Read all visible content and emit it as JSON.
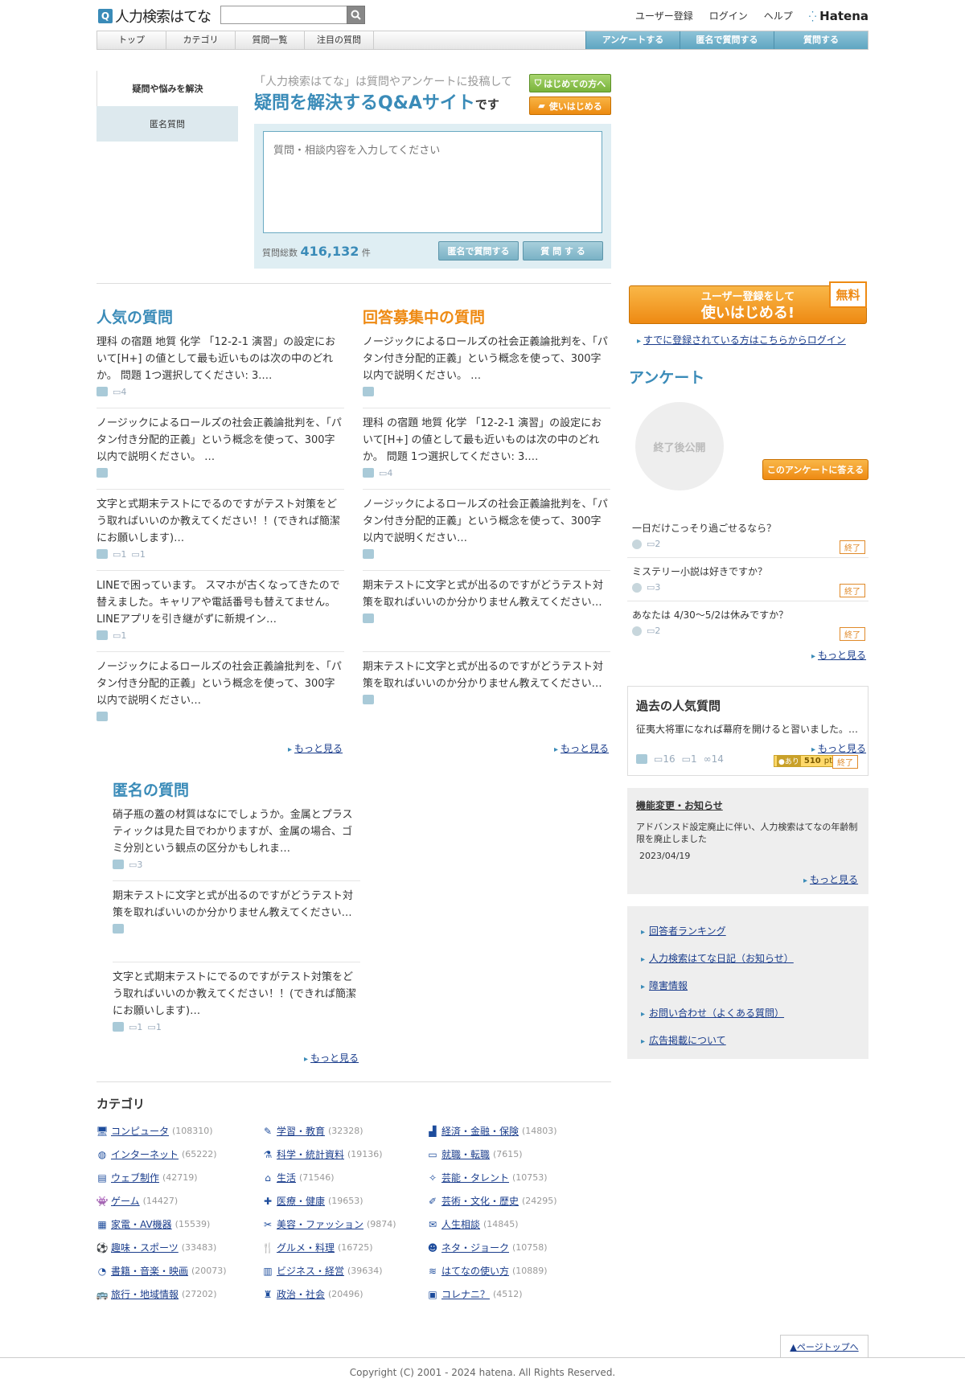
{
  "header": {
    "logo_text": "人力検索はてな",
    "links": [
      "ユーザー登録",
      "ログイン",
      "ヘルプ"
    ],
    "hatena": "Hatena"
  },
  "nav": {
    "tabs": [
      "トップ",
      "カテゴリ",
      "質問一覧",
      "注目の質問"
    ],
    "actions": [
      "アンケートする",
      "匿名で質問する",
      "質問する"
    ]
  },
  "sidetabs": [
    "疑問や悩みを解決",
    "匿名質問"
  ],
  "intro": {
    "line1": "「人力検索はてな」は質問やアンケートに投稿して",
    "line2": "疑問を解決するQ&Aサイト",
    "line2_suffix": "です",
    "btn_first": "はじめての方へ",
    "btn_howto": "使いはじめる"
  },
  "askform": {
    "placeholder": "質問・相談内容を入力してください",
    "count_label": "質問総数",
    "count": "416,132",
    "count_unit": "件",
    "btn_anon": "匿名で質問する",
    "btn_ask": "質 問 す る"
  },
  "popular": {
    "title": "人気の質問",
    "items": [
      {
        "text": "理科 の宿題 地質 化学 「12-2-1 演習」の設定において[H+] の値として最も近いものは次の中のどれか。 問題 1つ選択してください: 3.…",
        "ans": "4",
        "bm": ""
      },
      {
        "text": "ノージックによるロールズの社会正義論批判を、「パタン付き分配的正義」という概念を使って、300字以内で説明ください。 …",
        "ans": "",
        "bm": ""
      },
      {
        "text": "文字と式期末テストにでるのですがテスト対策をどう取ればいいのか教えてください！！(できれば簡潔にお願いします)…",
        "ans": "1",
        "bm": "1"
      },
      {
        "text": "LINEで困っています。 スマホが古くなってきたので替えました。キャリアや電話番号も替えてません。LINEアプリを引き継がずに新規イン…",
        "ans": "1",
        "bm": ""
      },
      {
        "text": "ノージックによるロールズの社会正義論批判を、「パタン付き分配的正義」という概念を使って、300字以内で説明ください…",
        "ans": "",
        "bm": ""
      }
    ],
    "more": "もっと見る"
  },
  "recruiting": {
    "title": "回答募集中の質問",
    "items": [
      {
        "text": "ノージックによるロールズの社会正義論批判を、「パタン付き分配的正義」という概念を使って、300字以内で説明ください。 …",
        "ans": "",
        "bm": ""
      },
      {
        "text": "理科 の宿題 地質 化学 「12-2-1 演習」の設定において[H+] の値として最も近いものは次の中のどれか。 問題 1つ選択してください: 3.…",
        "ans": "4",
        "bm": ""
      },
      {
        "text": "ノージックによるロールズの社会正義論批判を、「パタン付き分配的正義」という概念を使って、300字以内で説明ください…",
        "ans": "",
        "bm": ""
      },
      {
        "text": "期末テストに文字と式が出るのですがどうテスト対策を取ればいいのか分かりません教えてください…",
        "ans": "",
        "bm": ""
      },
      {
        "text": "期末テストに文字と式が出るのですがどうテスト対策を取ればいいのか分かりません教えてください…",
        "ans": "",
        "bm": ""
      }
    ],
    "more": "もっと見る"
  },
  "anonymous": {
    "title": "匿名の質問",
    "items": [
      {
        "text": "硝子瓶の蓋の材質はなにでしょうか。金属とプラスティックは見た目でわかりますが、金属の場合、ゴミ分別という観点の区分かもしれま…",
        "ans": "3",
        "bm": ""
      },
      {
        "text": "期末テストに文字と式が出るのですがどうテスト対策を取ればいいのか分かりません教えてください…",
        "ans": "",
        "bm": ""
      },
      {
        "text": "文字と式期末テストにでるのですがテスト対策をどう取ればいいのか教えてください！！(できれば簡潔にお願いします)…",
        "ans": "1",
        "bm": "1"
      }
    ],
    "more": "もっと見る"
  },
  "register": {
    "line1": "ユーザー登録をして",
    "line2": "使いはじめる!",
    "free": "無料",
    "already": "すでに登録されている方はこちらからログイン"
  },
  "survey": {
    "title": "アンケート",
    "circle": "終了後公開",
    "answer_btn": "このアンケートに答える",
    "items": [
      {
        "text": "一日だけこっそり過ごせるなら？",
        "ans": "2",
        "status": "終了"
      },
      {
        "text": "ミステリー小説は好きですか？",
        "ans": "3",
        "status": "終了"
      },
      {
        "text": "あなたは 4/30〜5/2は休みですか？",
        "ans": "2",
        "status": "終了"
      }
    ],
    "more": "もっと見る"
  },
  "past": {
    "title": "過去の人気質問",
    "text": "征夷大将軍になれば幕府を開けると習いました。…",
    "ans": "16",
    "bm": "1",
    "links": "14",
    "point_tag": "あり",
    "points": "510",
    "points_unit": "pt",
    "status": "終了",
    "more": "もっと見る"
  },
  "news": {
    "title": "機能変更・お知らせ",
    "body": "アドバンスド設定廃止に伴い、人力検索はてなの年齢制限を廃止しました",
    "date": "2023/04/19",
    "more": "もっと見る"
  },
  "links": [
    "回答者ランキング",
    "人力検索はてな日記（お知らせ）",
    "障害情報",
    "お問い合わせ（よくある質問）",
    "広告掲載について"
  ],
  "categories": {
    "title": "カテゴリ",
    "items": [
      {
        "name": "コンピュータ",
        "count": "(108310)",
        "icon": "computer-icon",
        "glyph": "🖥"
      },
      {
        "name": "インターネット",
        "count": "(65222)",
        "icon": "globe-icon",
        "glyph": "◍"
      },
      {
        "name": "ウェブ制作",
        "count": "(42719)",
        "icon": "web-icon",
        "glyph": "▤"
      },
      {
        "name": "ゲーム",
        "count": "(14427)",
        "icon": "game-icon",
        "glyph": "👾"
      },
      {
        "name": "家電・AV機器",
        "count": "(15539)",
        "icon": "appliance-icon",
        "glyph": "▦"
      },
      {
        "name": "趣味・スポーツ",
        "count": "(33483)",
        "icon": "ball-icon",
        "glyph": "⚽"
      },
      {
        "name": "書籍・音楽・映画",
        "count": "(20073)",
        "icon": "disc-icon",
        "glyph": "◔"
      },
      {
        "name": "旅行・地域情報",
        "count": "(27202)",
        "icon": "travel-icon",
        "glyph": "🚌"
      },
      {
        "name": "学習・教育",
        "count": "(32328)",
        "icon": "pencil-icon",
        "glyph": "✎"
      },
      {
        "name": "科学・統計資料",
        "count": "(19136)",
        "icon": "flask-icon",
        "glyph": "⚗"
      },
      {
        "name": "生活",
        "count": "(71546)",
        "icon": "home-icon",
        "glyph": "⌂"
      },
      {
        "name": "医療・健康",
        "count": "(19653)",
        "icon": "medical-icon",
        "glyph": "✚"
      },
      {
        "name": "美容・ファッション",
        "count": "(9874)",
        "icon": "beauty-icon",
        "glyph": "✂"
      },
      {
        "name": "グルメ・料理",
        "count": "(16725)",
        "icon": "food-icon",
        "glyph": "🍴"
      },
      {
        "name": "ビジネス・経営",
        "count": "(39634)",
        "icon": "building-icon",
        "glyph": "▥"
      },
      {
        "name": "政治・社会",
        "count": "(20496)",
        "icon": "politics-icon",
        "glyph": "♜"
      },
      {
        "name": "経済・金融・保険",
        "count": "(14803)",
        "icon": "economy-icon",
        "glyph": "▟"
      },
      {
        "name": "就職・転職",
        "count": "(7615)",
        "icon": "job-icon",
        "glyph": "▭"
      },
      {
        "name": "芸能・タレント",
        "count": "(10753)",
        "icon": "mic-icon",
        "glyph": "✧"
      },
      {
        "name": "芸術・文化・歴史",
        "count": "(24295)",
        "icon": "art-icon",
        "glyph": "✐"
      },
      {
        "name": "人生相談",
        "count": "(14845)",
        "icon": "consult-icon",
        "glyph": "✉"
      },
      {
        "name": "ネタ・ジョーク",
        "count": "(10758)",
        "icon": "smile-icon",
        "glyph": "☻"
      },
      {
        "name": "はてなの使い方",
        "count": "(10889)",
        "icon": "wifi-icon",
        "glyph": "≋"
      },
      {
        "name": "コレナニ？",
        "count": "(4512)",
        "icon": "question-icon",
        "glyph": "▣"
      }
    ]
  },
  "footer": {
    "pagetop": "▲ページトップへ",
    "copyright": "Copyright (C) 2001 - 2024 hatena. All Rights Reserved."
  }
}
